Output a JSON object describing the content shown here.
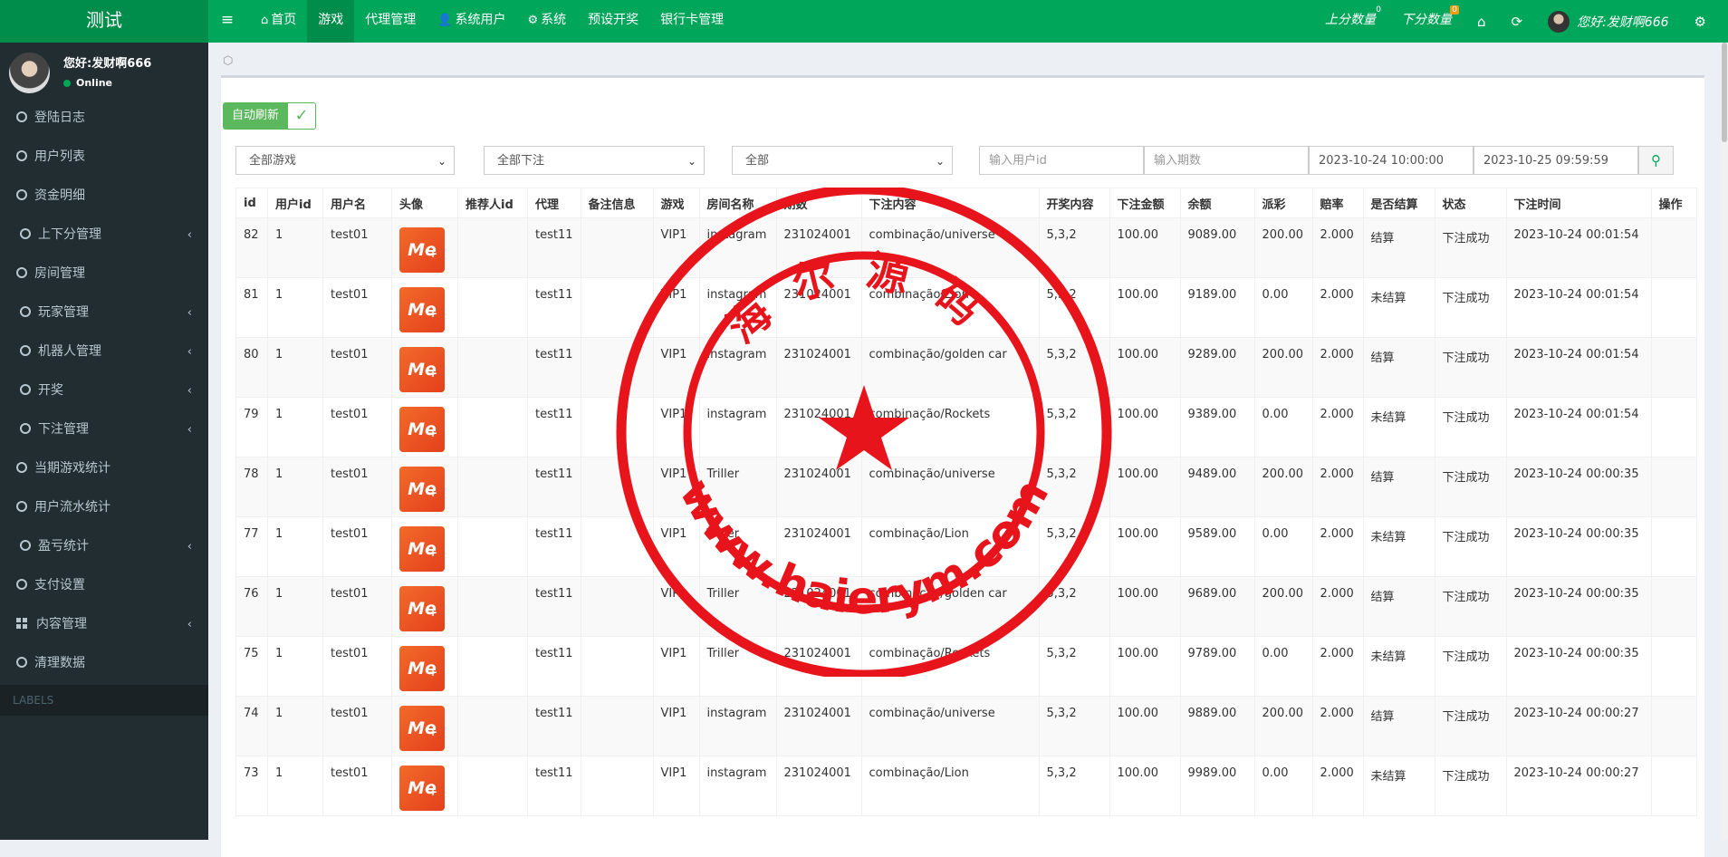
{
  "app": {
    "brand": "测试"
  },
  "topnav": [
    {
      "label": "首页",
      "icon": "home-icon",
      "glyph": "⌂",
      "active": false
    },
    {
      "label": "游戏",
      "icon": "",
      "glyph": "",
      "active": true
    },
    {
      "label": "代理管理",
      "icon": "",
      "glyph": "",
      "active": false
    },
    {
      "label": "系统用户",
      "icon": "user-icon",
      "glyph": "👤",
      "active": false
    },
    {
      "label": "系统",
      "icon": "gear-icon",
      "glyph": "⚙",
      "active": false
    },
    {
      "label": "预设开奖",
      "icon": "",
      "glyph": "",
      "active": false
    },
    {
      "label": "银行卡管理",
      "icon": "",
      "glyph": "",
      "active": false
    }
  ],
  "topright": {
    "up_label": "上分数量",
    "up_count": "0",
    "down_label": "下分数量",
    "down_count": "0",
    "greeting": "您好:发财啊666"
  },
  "sidebar": {
    "user_name": "您好:发财啊666",
    "status": "Online",
    "items": [
      {
        "label": "登陆日志",
        "chevron": false,
        "icon": "circle"
      },
      {
        "label": "用户列表",
        "chevron": false,
        "icon": "circle"
      },
      {
        "label": "资金明细",
        "chevron": false,
        "icon": "circle"
      },
      {
        "label": "上下分管理",
        "chevron": true,
        "icon": "circle"
      },
      {
        "label": "房间管理",
        "chevron": false,
        "icon": "circle"
      },
      {
        "label": "玩家管理",
        "chevron": true,
        "icon": "circle"
      },
      {
        "label": "机器人管理",
        "chevron": true,
        "icon": "circle"
      },
      {
        "label": "开奖",
        "chevron": true,
        "icon": "circle"
      },
      {
        "label": "下注管理",
        "chevron": true,
        "icon": "circle"
      },
      {
        "label": "当期游戏统计",
        "chevron": false,
        "icon": "circle"
      },
      {
        "label": "用户流水统计",
        "chevron": false,
        "icon": "circle"
      },
      {
        "label": "盈亏统计",
        "chevron": true,
        "icon": "circle"
      },
      {
        "label": "支付设置",
        "chevron": false,
        "icon": "circle"
      },
      {
        "label": "内容管理",
        "chevron": true,
        "icon": "grid"
      },
      {
        "label": "清理数据",
        "chevron": false,
        "icon": "circle"
      }
    ],
    "labels_header": "LABELS"
  },
  "toolbar": {
    "auto_refresh": "自动刷新"
  },
  "filters": {
    "game_select": "全部游戏",
    "bet_select": "全部下注",
    "all_select": "全部",
    "user_id_placeholder": "输入用户id",
    "period_placeholder": "输入期数",
    "start_time": "2023-10-24 10:00:00",
    "end_time": "2023-10-25 09:59:59"
  },
  "table": {
    "headers": [
      "id",
      "用户id",
      "用户名",
      "头像",
      "推荐人id",
      "代理",
      "备注信息",
      "游戏",
      "房间名称",
      "期数",
      "下注内容",
      "开奖内容",
      "下注金额",
      "余额",
      "派彩",
      "赔率",
      "是否结算",
      "状态",
      "下注时间",
      "操作"
    ],
    "rows": [
      {
        "id": "82",
        "uid": "1",
        "username": "test01",
        "referrer": "",
        "agent": "test11",
        "note": "",
        "game": "VIP1",
        "room": "instagram",
        "period": "231024001",
        "bet": "combinação/universe",
        "result": "5,3,2",
        "amount": "100.00",
        "balance": "9089.00",
        "payout": "200.00",
        "odds": "2.000",
        "settled": "结算",
        "status": "下注成功",
        "time": "2023-10-24 00:01:54"
      },
      {
        "id": "81",
        "uid": "1",
        "username": "test01",
        "referrer": "",
        "agent": "test11",
        "note": "",
        "game": "VIP1",
        "room": "instagram",
        "period": "231024001",
        "bet": "combinação/Lion",
        "result": "5,3,2",
        "amount": "100.00",
        "balance": "9189.00",
        "payout": "0.00",
        "odds": "2.000",
        "settled": "未结算",
        "status": "下注成功",
        "time": "2023-10-24 00:01:54"
      },
      {
        "id": "80",
        "uid": "1",
        "username": "test01",
        "referrer": "",
        "agent": "test11",
        "note": "",
        "game": "VIP1",
        "room": "instagram",
        "period": "231024001",
        "bet": "combinação/golden car",
        "result": "5,3,2",
        "amount": "100.00",
        "balance": "9289.00",
        "payout": "200.00",
        "odds": "2.000",
        "settled": "结算",
        "status": "下注成功",
        "time": "2023-10-24 00:01:54"
      },
      {
        "id": "79",
        "uid": "1",
        "username": "test01",
        "referrer": "",
        "agent": "test11",
        "note": "",
        "game": "VIP1",
        "room": "instagram",
        "period": "231024001",
        "bet": "combinação/Rockets",
        "result": "5,3,2",
        "amount": "100.00",
        "balance": "9389.00",
        "payout": "0.00",
        "odds": "2.000",
        "settled": "未结算",
        "status": "下注成功",
        "time": "2023-10-24 00:01:54"
      },
      {
        "id": "78",
        "uid": "1",
        "username": "test01",
        "referrer": "",
        "agent": "test11",
        "note": "",
        "game": "VIP1",
        "room": "Triller",
        "period": "231024001",
        "bet": "combinação/universe",
        "result": "5,3,2",
        "amount": "100.00",
        "balance": "9489.00",
        "payout": "200.00",
        "odds": "2.000",
        "settled": "结算",
        "status": "下注成功",
        "time": "2023-10-24 00:00:35"
      },
      {
        "id": "77",
        "uid": "1",
        "username": "test01",
        "referrer": "",
        "agent": "test11",
        "note": "",
        "game": "VIP1",
        "room": "Triller",
        "period": "231024001",
        "bet": "combinação/Lion",
        "result": "5,3,2",
        "amount": "100.00",
        "balance": "9589.00",
        "payout": "0.00",
        "odds": "2.000",
        "settled": "未结算",
        "status": "下注成功",
        "time": "2023-10-24 00:00:35"
      },
      {
        "id": "76",
        "uid": "1",
        "username": "test01",
        "referrer": "",
        "agent": "test11",
        "note": "",
        "game": "VIP1",
        "room": "Triller",
        "period": "231024001",
        "bet": "combinação/golden car",
        "result": "5,3,2",
        "amount": "100.00",
        "balance": "9689.00",
        "payout": "200.00",
        "odds": "2.000",
        "settled": "结算",
        "status": "下注成功",
        "time": "2023-10-24 00:00:35"
      },
      {
        "id": "75",
        "uid": "1",
        "username": "test01",
        "referrer": "",
        "agent": "test11",
        "note": "",
        "game": "VIP1",
        "room": "Triller",
        "period": "231024001",
        "bet": "combinação/Rockets",
        "result": "5,3,2",
        "amount": "100.00",
        "balance": "9789.00",
        "payout": "0.00",
        "odds": "2.000",
        "settled": "未结算",
        "status": "下注成功",
        "time": "2023-10-24 00:00:35"
      },
      {
        "id": "74",
        "uid": "1",
        "username": "test01",
        "referrer": "",
        "agent": "test11",
        "note": "",
        "game": "VIP1",
        "room": "instagram",
        "period": "231024001",
        "bet": "combinação/universe",
        "result": "5,3,2",
        "amount": "100.00",
        "balance": "9889.00",
        "payout": "200.00",
        "odds": "2.000",
        "settled": "结算",
        "status": "下注成功",
        "time": "2023-10-24 00:00:27"
      },
      {
        "id": "73",
        "uid": "1",
        "username": "test01",
        "referrer": "",
        "agent": "test11",
        "note": "",
        "game": "VIP1",
        "room": "instagram",
        "period": "231024001",
        "bet": "combinação/Lion",
        "result": "5,3,2",
        "amount": "100.00",
        "balance": "9989.00",
        "payout": "0.00",
        "odds": "2.000",
        "settled": "未结算",
        "status": "下注成功",
        "time": "2023-10-24 00:00:27"
      }
    ]
  },
  "watermark": {
    "top_text": "海尔源码",
    "bottom_text": "www.haierym.com",
    "color": "#e8141b"
  },
  "colors": {
    "brand_green": "#00a65a",
    "brand_green_dark": "#008d4c",
    "sidebar_bg": "#222d32",
    "app_icon": "#ee5a24"
  }
}
